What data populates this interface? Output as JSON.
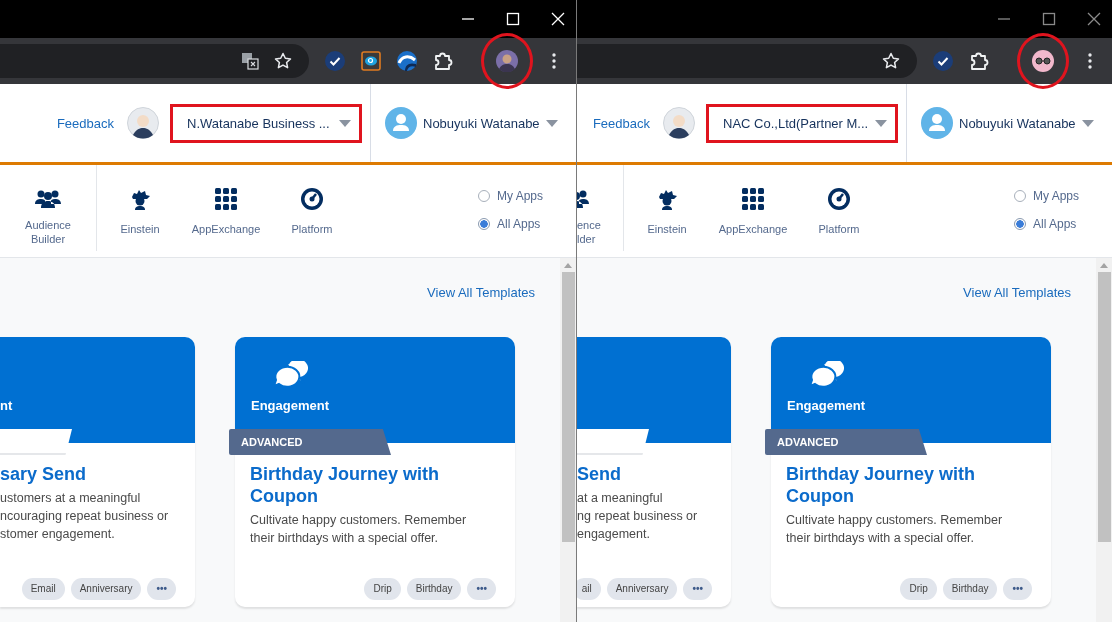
{
  "panes": [
    {
      "window": {
        "active": true
      },
      "address_bar_icons": [
        {
          "kind": "translate"
        },
        {
          "kind": "star"
        }
      ],
      "extensions": [
        {
          "kind": "check"
        },
        {
          "kind": "magnifier"
        },
        {
          "kind": "wave"
        },
        {
          "kind": "puzzle"
        }
      ],
      "profile": {
        "kind": "person",
        "highlighted": true
      },
      "header": {
        "feedback": "Feedback",
        "org": {
          "name": "N.Watanabe Business ...",
          "highlighted": true
        },
        "user": "Nobuyuki Watanabe"
      },
      "apps": [
        {
          "kind": "audience",
          "lines": [
            "Audience",
            "Builder"
          ]
        },
        {
          "kind": "einstein",
          "lines": [
            "Einstein"
          ]
        },
        {
          "kind": "grid",
          "lines": [
            "AppExchange"
          ]
        },
        {
          "kind": "gauge",
          "lines": [
            "Platform"
          ]
        }
      ],
      "app_filter": [
        {
          "label": "My Apps",
          "selected": false
        },
        {
          "label": "All Apps",
          "selected": true
        }
      ],
      "view_all": "View All Templates",
      "cards": [
        {
          "category": "nt",
          "ribbon": {
            "kind": "basic"
          },
          "title": "sary Send",
          "description": [
            "ustomers at a meaningful",
            "ncouraging repeat business or",
            "stomer engagement."
          ],
          "tags": [
            "Email",
            "Anniversary"
          ],
          "more": "•••"
        },
        {
          "kind": "engagement",
          "category": "Engagement",
          "ribbon": {
            "kind": "advanced",
            "label": "ADVANCED"
          },
          "title": "Birthday Journey with Coupon",
          "description": [
            "Cultivate happy customers. Remember",
            "their birthdays with a special offer."
          ],
          "tags": [
            "Drip",
            "Birthday"
          ],
          "more": "•••"
        }
      ]
    },
    {
      "window": {
        "active": false
      },
      "address_bar_icons": [
        {
          "kind": "star"
        }
      ],
      "extensions": [
        {
          "kind": "check"
        },
        {
          "kind": "puzzle"
        }
      ],
      "profile": {
        "kind": "glasses",
        "highlighted": true
      },
      "header": {
        "feedback": "Feedback",
        "org": {
          "name": "NAC Co.,Ltd(Partner M...",
          "highlighted": true
        },
        "user": "Nobuyuki Watanabe"
      },
      "apps": [
        {
          "kind": "audience",
          "lines": [
            "ence",
            "lder"
          ]
        },
        {
          "kind": "einstein",
          "lines": [
            "Einstein"
          ]
        },
        {
          "kind": "grid",
          "lines": [
            "AppExchange"
          ]
        },
        {
          "kind": "gauge",
          "lines": [
            "Platform"
          ]
        }
      ],
      "app_filter": [
        {
          "label": "My Apps",
          "selected": false
        },
        {
          "label": "All Apps",
          "selected": true
        }
      ],
      "view_all": "View All Templates",
      "cards": [
        {
          "ribbon": {
            "kind": "basic"
          },
          "title": "Send",
          "description": [
            "at a meaningful",
            "ng repeat business or",
            "engagement."
          ],
          "tags": [
            "ail",
            "Anniversary"
          ],
          "more": "•••"
        },
        {
          "kind": "engagement",
          "category": "Engagement",
          "ribbon": {
            "kind": "advanced",
            "label": "ADVANCED"
          },
          "title": "Birthday Journey with Coupon",
          "description": [
            "Cultivate happy customers. Remember",
            "their birthdays with a special offer."
          ],
          "tags": [
            "Drip",
            "Birthday"
          ],
          "more": "•••"
        }
      ]
    }
  ]
}
